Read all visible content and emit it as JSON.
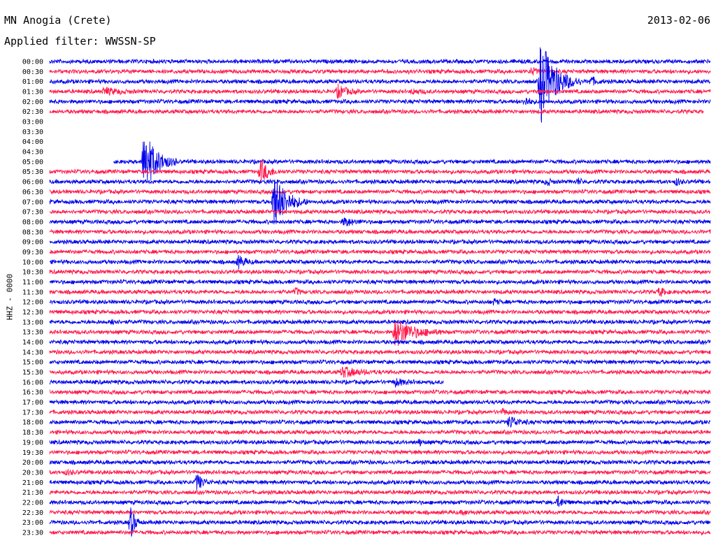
{
  "header": {
    "station": "MN Anogia (Crete)",
    "filter": "Applied filter: WWSSN-SP",
    "date": "2013-02-06",
    "channel": "HHZ - 0000"
  },
  "colors": {
    "odd_trace": "#0000ee",
    "even_trace": "#ff1a4d"
  },
  "chart_data": {
    "type": "line",
    "title": "MN Anogia (Crete)",
    "subtitle": "Applied filter: WWSSN-SP",
    "date": "2013-02-06",
    "ylabel": "HHZ - 0000",
    "row_labels": [
      "00:00",
      "00:30",
      "01:00",
      "01:30",
      "02:00",
      "02:30",
      "03:00",
      "03:30",
      "04:00",
      "04:30",
      "05:00",
      "05:30",
      "06:00",
      "06:30",
      "07:00",
      "07:30",
      "08:00",
      "08:30",
      "09:00",
      "09:30",
      "10:00",
      "10:30",
      "11:00",
      "11:30",
      "12:00",
      "12:30",
      "13:00",
      "13:30",
      "14:00",
      "14:30",
      "15:00",
      "15:30",
      "16:00",
      "16:30",
      "17:00",
      "17:30",
      "18:00",
      "18:30",
      "19:00",
      "19:30",
      "20:00",
      "20:30",
      "21:00",
      "21:30",
      "22:00",
      "22:30",
      "23:00",
      "23:30"
    ],
    "x_unit": "minutes into row",
    "xlim": [
      0,
      30
    ],
    "trace_coverage": [
      [
        0,
        30
      ],
      [
        0,
        30
      ],
      [
        0,
        30
      ],
      [
        0,
        30
      ],
      [
        0,
        30
      ],
      [
        0,
        29.7
      ],
      null,
      null,
      null,
      null,
      [
        2.9,
        30
      ],
      [
        0,
        30
      ],
      [
        0,
        30
      ],
      [
        0,
        30
      ],
      [
        0,
        30
      ],
      [
        0,
        30
      ],
      [
        0,
        30
      ],
      [
        0,
        30
      ],
      [
        0,
        30
      ],
      [
        0,
        30
      ],
      [
        0,
        30
      ],
      [
        0,
        30
      ],
      [
        0,
        30
      ],
      [
        0,
        30
      ],
      [
        0,
        30
      ],
      [
        0,
        30
      ],
      [
        0,
        30
      ],
      [
        0,
        30
      ],
      [
        0,
        30
      ],
      [
        0,
        30
      ],
      [
        0,
        30
      ],
      [
        0,
        30
      ],
      [
        0,
        17.9
      ],
      [
        0,
        30
      ],
      [
        0,
        30
      ],
      [
        0,
        30
      ],
      [
        0,
        30
      ],
      [
        0,
        30
      ],
      [
        0,
        30
      ],
      [
        0,
        30
      ],
      [
        0,
        30
      ],
      [
        0,
        30
      ],
      [
        0,
        30
      ],
      [
        0,
        30
      ],
      [
        0,
        30
      ],
      [
        0,
        30
      ],
      [
        0,
        30
      ],
      [
        0,
        30
      ]
    ],
    "events": [
      {
        "row": 1,
        "minute": 21.9,
        "amp": 0.5,
        "dur": 0.6
      },
      {
        "row": 2,
        "minute": 22.3,
        "amp": 6.0,
        "dur": 1.8
      },
      {
        "row": 2,
        "minute": 24.6,
        "amp": 0.6,
        "dur": 0.6
      },
      {
        "row": 3,
        "minute": 2.5,
        "amp": 0.5,
        "dur": 1.5
      },
      {
        "row": 3,
        "minute": 13.1,
        "amp": 0.9,
        "dur": 1.0
      },
      {
        "row": 3,
        "minute": 16.5,
        "amp": 0.3,
        "dur": 1.0
      },
      {
        "row": 4,
        "minute": 21.6,
        "amp": 0.6,
        "dur": 0.6
      },
      {
        "row": 10,
        "minute": 4.3,
        "amp": 4.5,
        "dur": 1.5
      },
      {
        "row": 11,
        "minute": 9.6,
        "amp": 1.7,
        "dur": 0.9
      },
      {
        "row": 12,
        "minute": 22.6,
        "amp": 0.5,
        "dur": 0.4
      },
      {
        "row": 12,
        "minute": 24.0,
        "amp": 0.4,
        "dur": 0.4
      },
      {
        "row": 12,
        "minute": 28.5,
        "amp": 0.5,
        "dur": 0.3
      },
      {
        "row": 14,
        "minute": 10.2,
        "amp": 4.0,
        "dur": 1.5
      },
      {
        "row": 16,
        "minute": 13.4,
        "amp": 0.6,
        "dur": 1.0
      },
      {
        "row": 20,
        "minute": 8.6,
        "amp": 0.9,
        "dur": 0.7
      },
      {
        "row": 23,
        "minute": 11.2,
        "amp": 0.5,
        "dur": 0.4
      },
      {
        "row": 23,
        "minute": 27.7,
        "amp": 0.6,
        "dur": 0.6
      },
      {
        "row": 24,
        "minute": 20.2,
        "amp": 0.4,
        "dur": 0.4
      },
      {
        "row": 26,
        "minute": 2.9,
        "amp": 0.6,
        "dur": 0.3
      },
      {
        "row": 27,
        "minute": 15.7,
        "amp": 2.0,
        "dur": 2.2
      },
      {
        "row": 31,
        "minute": 13.3,
        "amp": 0.7,
        "dur": 1.8
      },
      {
        "row": 32,
        "minute": 15.7,
        "amp": 0.5,
        "dur": 1.0
      },
      {
        "row": 35,
        "minute": 20.6,
        "amp": 0.4,
        "dur": 0.4
      },
      {
        "row": 36,
        "minute": 20.9,
        "amp": 0.9,
        "dur": 0.9
      },
      {
        "row": 38,
        "minute": 16.8,
        "amp": 0.4,
        "dur": 0.4
      },
      {
        "row": 41,
        "minute": 0.8,
        "amp": 0.3,
        "dur": 0.6
      },
      {
        "row": 42,
        "minute": 6.7,
        "amp": 1.2,
        "dur": 0.7
      },
      {
        "row": 44,
        "minute": 23.1,
        "amp": 0.7,
        "dur": 0.6
      },
      {
        "row": 45,
        "minute": 18.8,
        "amp": 0.3,
        "dur": 0.6
      },
      {
        "row": 46,
        "minute": 3.7,
        "amp": 2.2,
        "dur": 0.5
      }
    ]
  }
}
